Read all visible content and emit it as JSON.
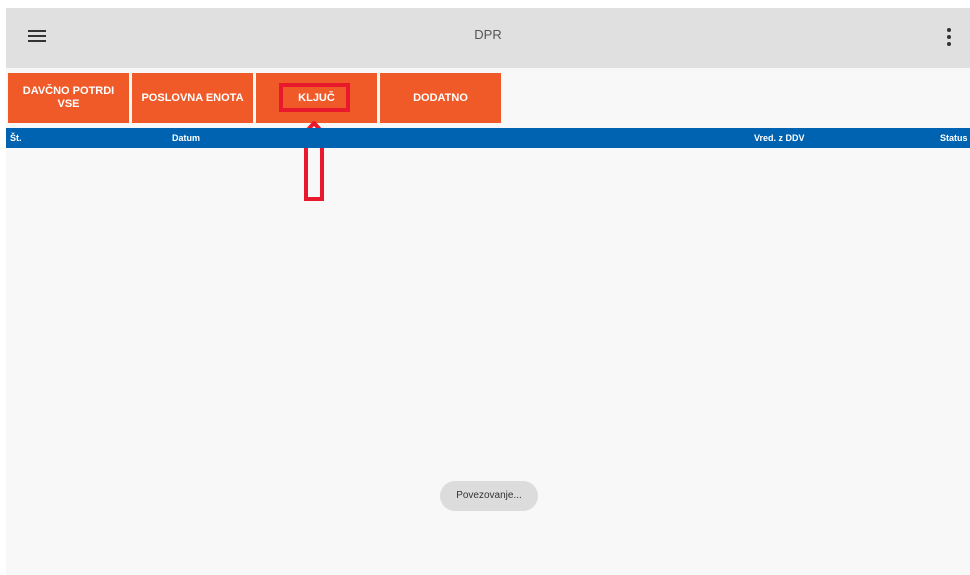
{
  "appbar": {
    "title": "DPR",
    "menu_icon": "hamburger-menu-icon",
    "overflow_icon": "more-vertical-icon"
  },
  "toolbar": {
    "buttons": [
      {
        "line1": "DAVČNO POTRDI",
        "line2": "VSE"
      },
      {
        "line1": "POSLOVNA ENOTA"
      },
      {
        "line1": "KLJUČ"
      },
      {
        "line1": "DODATNO"
      }
    ],
    "button_color": "#f05a28"
  },
  "annotation": {
    "highlight_color": "#e8192c",
    "arrow_icon": "up-arrow-icon"
  },
  "table": {
    "header_color": "#0063b1",
    "columns": [
      "Št.",
      "Datum",
      "Vred. z DDV",
      "Status"
    ],
    "rows": []
  },
  "toast": {
    "text": "Povezovanje..."
  }
}
